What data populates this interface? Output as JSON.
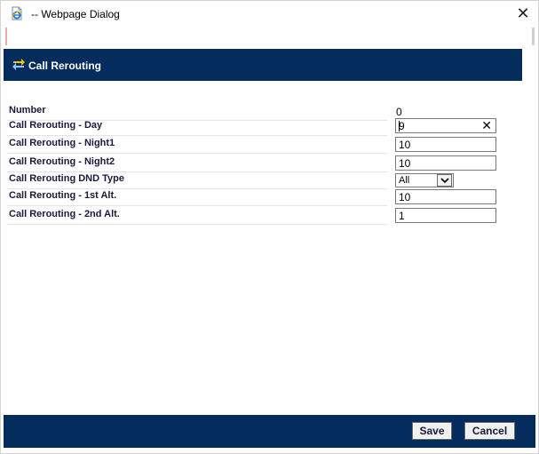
{
  "window": {
    "title": "-- Webpage Dialog",
    "icon": "ie-page-icon",
    "close_icon": "close-icon"
  },
  "header": {
    "title": "Call Rerouting",
    "icon": "reroute-arrows-icon",
    "bg_color": "#042d5d"
  },
  "form": {
    "number": {
      "label": "Number",
      "value": "0"
    },
    "day": {
      "label": "Call Rerouting - Day",
      "value": "9"
    },
    "night1": {
      "label": "Call Rerouting - Night1",
      "value": "10"
    },
    "night2": {
      "label": "Call Rerouting - Night2",
      "value": "10"
    },
    "dnd_type": {
      "label": "Call Rerouting DND Type",
      "value": "All"
    },
    "alt1": {
      "label": "Call Rerouting - 1st Alt.",
      "value": "10"
    },
    "alt2": {
      "label": "Call Rerouting - 2nd Alt.",
      "value": "1"
    }
  },
  "footer": {
    "save_label": "Save",
    "cancel_label": "Cancel",
    "bg_color": "#042d5d"
  }
}
